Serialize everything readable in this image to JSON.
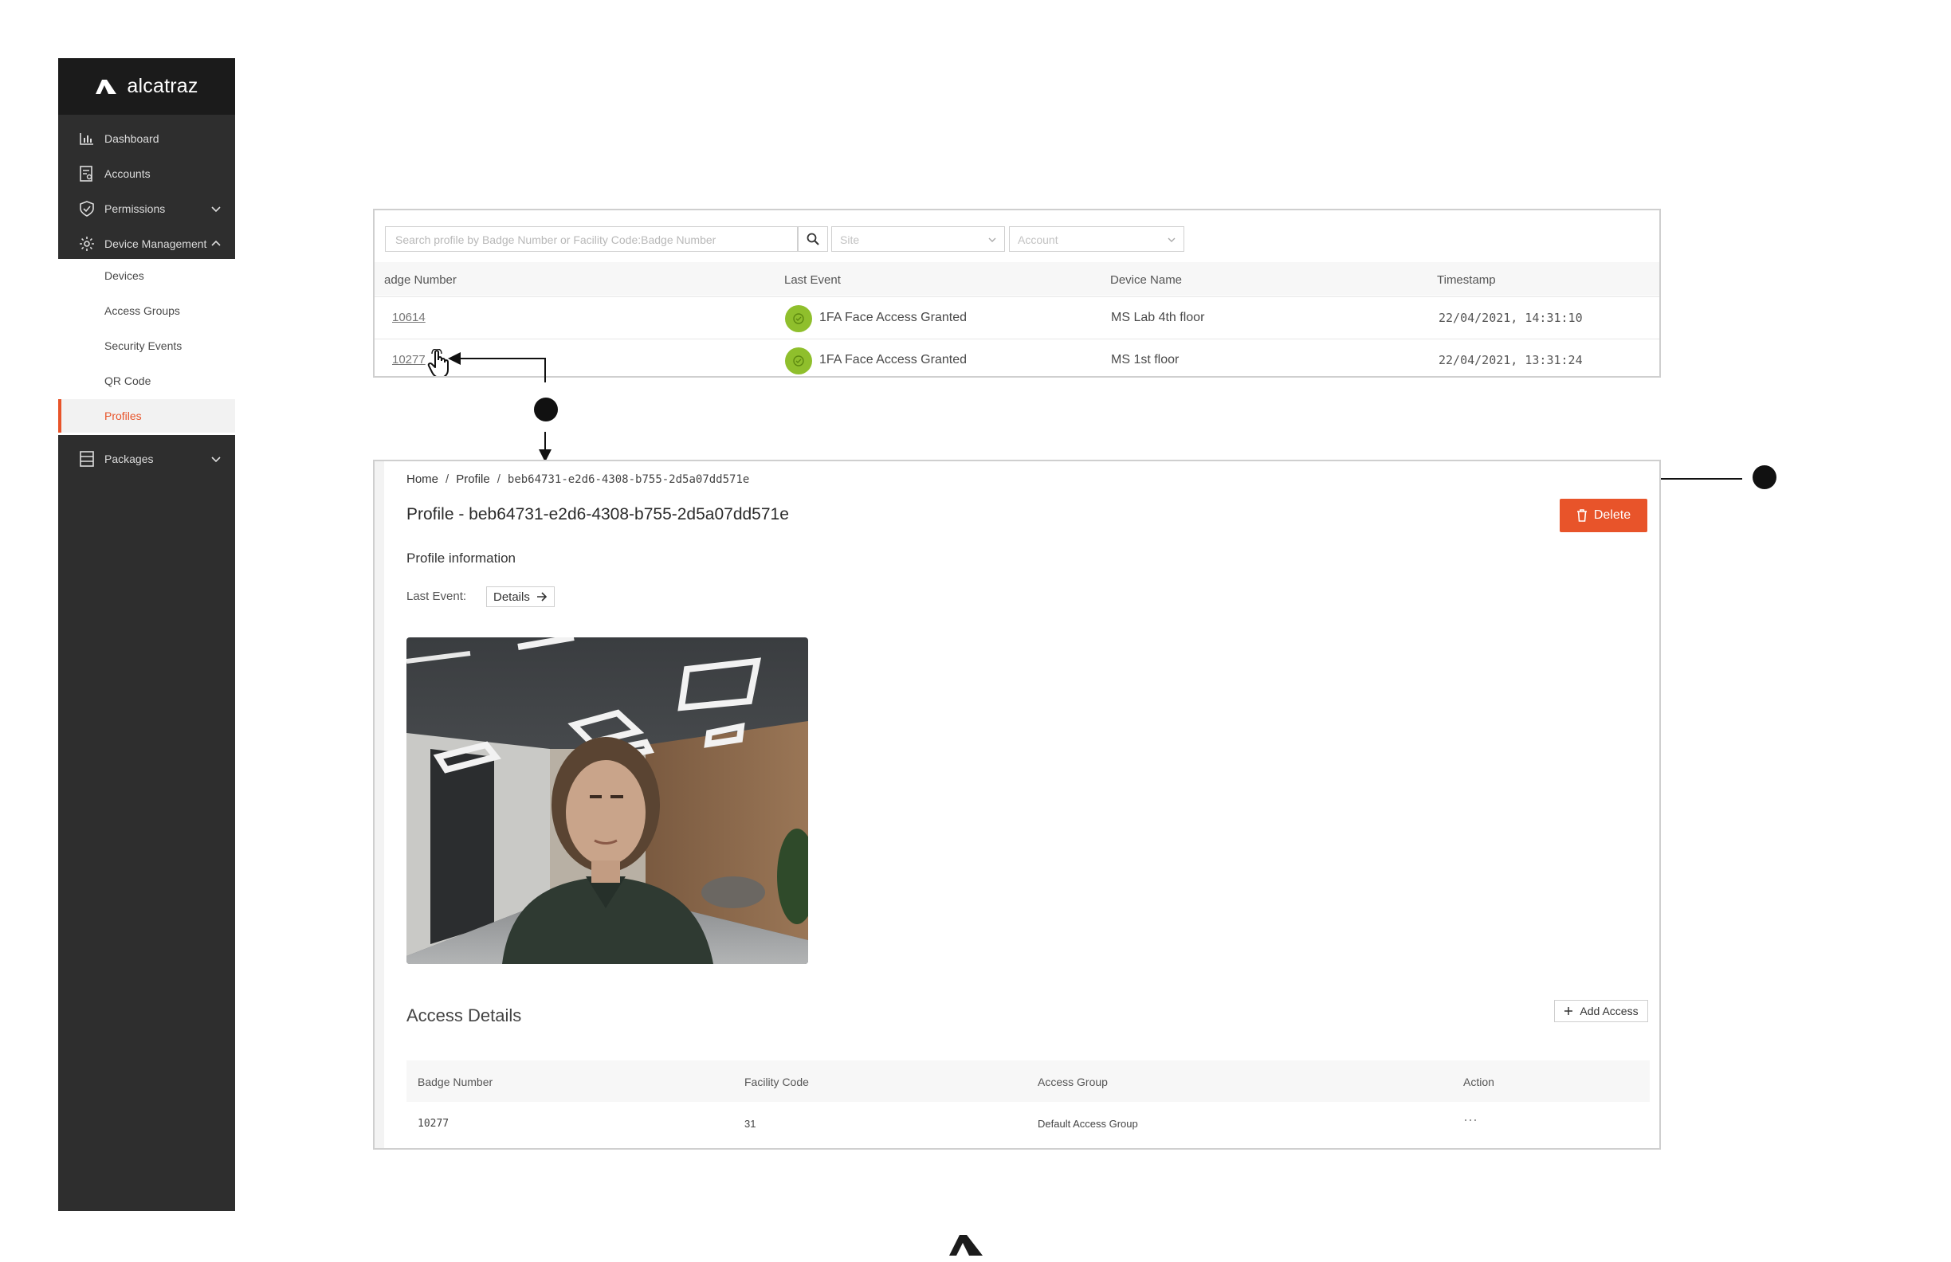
{
  "app": {
    "brand": "alcatraz",
    "accent": "#e8542a",
    "sidebar_bg": "#2e2e2e"
  },
  "sidebar": {
    "items": [
      {
        "label": "Dashboard",
        "icon": "chart-icon"
      },
      {
        "label": "Accounts",
        "icon": "accounts-icon"
      },
      {
        "label": "Permissions",
        "icon": "shield-icon"
      },
      {
        "label": "Device Management",
        "icon": "gear-icon"
      }
    ],
    "submenu": [
      {
        "label": "Devices"
      },
      {
        "label": "Access Groups"
      },
      {
        "label": "Security Events"
      },
      {
        "label": "QR Code"
      },
      {
        "label": "Profiles",
        "active": true
      }
    ],
    "packages": {
      "label": "Packages",
      "icon": "packages-icon"
    }
  },
  "events_table": {
    "search_placeholder": "Search profile by Badge Number or Facility Code:Badge Number",
    "site_placeholder": "Site",
    "account_placeholder": "Account",
    "columns": [
      "adge Number",
      "Last Event",
      "Device Name",
      "Timestamp"
    ],
    "rows": [
      {
        "badge": "10614",
        "event": "1FA Face Access Granted",
        "device": "MS Lab 4th floor",
        "timestamp": "22/04/2021, 14:31:10",
        "status_color": "#8fbf2c"
      },
      {
        "badge": "10277",
        "event": "1FA Face Access Granted",
        "device": "MS 1st floor",
        "timestamp": "22/04/2021, 13:31:24",
        "status_color": "#8fbf2c"
      }
    ]
  },
  "profile": {
    "breadcrumb": {
      "home": "Home",
      "profile": "Profile",
      "id": "beb64731-e2d6-4308-b755-2d5a07dd571e"
    },
    "title": "Profile - beb64731-e2d6-4308-b755-2d5a07dd571e",
    "delete_label": "Delete",
    "section_label": "Profile information",
    "last_event_label": "Last Event:",
    "details_label": "Details"
  },
  "access_details": {
    "title": "Access Details",
    "add_label": "Add Access",
    "columns": [
      "Badge Number",
      "Facility Code",
      "Access Group",
      "Action"
    ],
    "rows": [
      {
        "badge": "10277",
        "facility": "31",
        "group": "Default Access Group",
        "action": "···"
      }
    ]
  }
}
